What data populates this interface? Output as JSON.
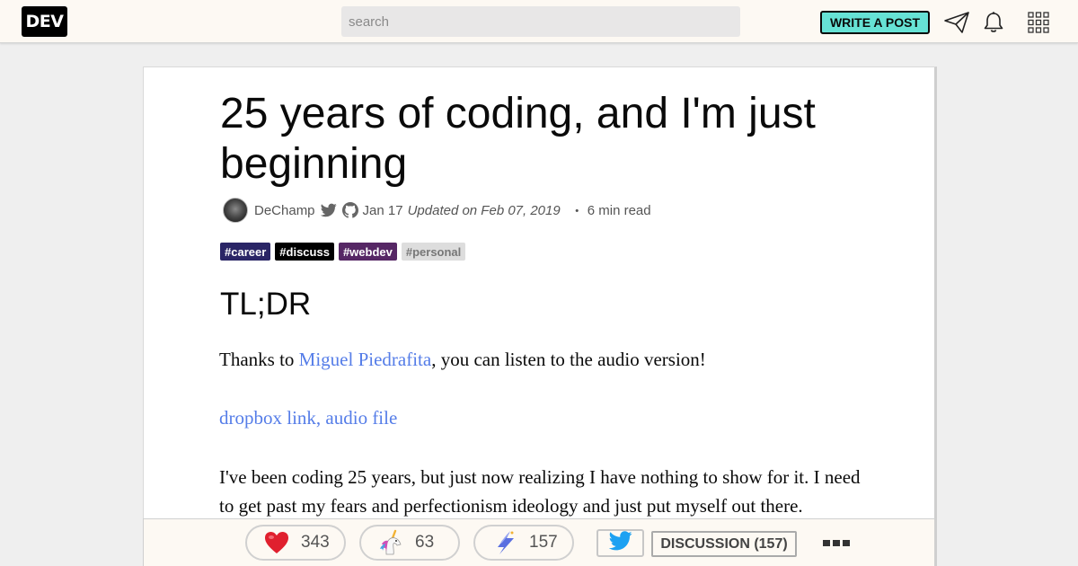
{
  "nav": {
    "logo": "DEV",
    "search_placeholder": "search",
    "write_post_label": "WRITE A POST",
    "icons": [
      "paper-plane-icon",
      "bell-icon",
      "grid-menu-icon"
    ]
  },
  "article": {
    "title": "25 years of coding, and I'm just beginning",
    "author": "DeChamp",
    "date": "Jan 17",
    "updated": "Updated on Feb 07, 2019",
    "dot": "・",
    "read_time": "6 min read",
    "tags": [
      {
        "label": "#career",
        "bg": "#2a2566",
        "fg": "#ffffff"
      },
      {
        "label": "#discuss",
        "bg": "#000000",
        "fg": "#ffffff"
      },
      {
        "label": "#webdev",
        "bg": "#562765",
        "fg": "#ffffff"
      },
      {
        "label": "#personal",
        "bg": "#dddddd",
        "fg": "#777777"
      }
    ],
    "heading": "TL;DR",
    "para1_prefix": "Thanks to ",
    "para1_link": "Miguel Piedrafita",
    "para1_suffix": ", you can listen to the audio version!",
    "audio_link": "dropbox link, audio file",
    "para3": "I've been coding 25 years, but just now realizing I have nothing to show for it. I need to get past my fears and perfectionism ideology and just put myself out there."
  },
  "reactions": {
    "hearts": "343",
    "unicorns": "63",
    "bookmarks": "157",
    "discussion_label": "DISCUSSION (157)"
  },
  "colors": {
    "accent": "#66e2d5",
    "link": "#557de8",
    "heart": "#e0202e"
  }
}
